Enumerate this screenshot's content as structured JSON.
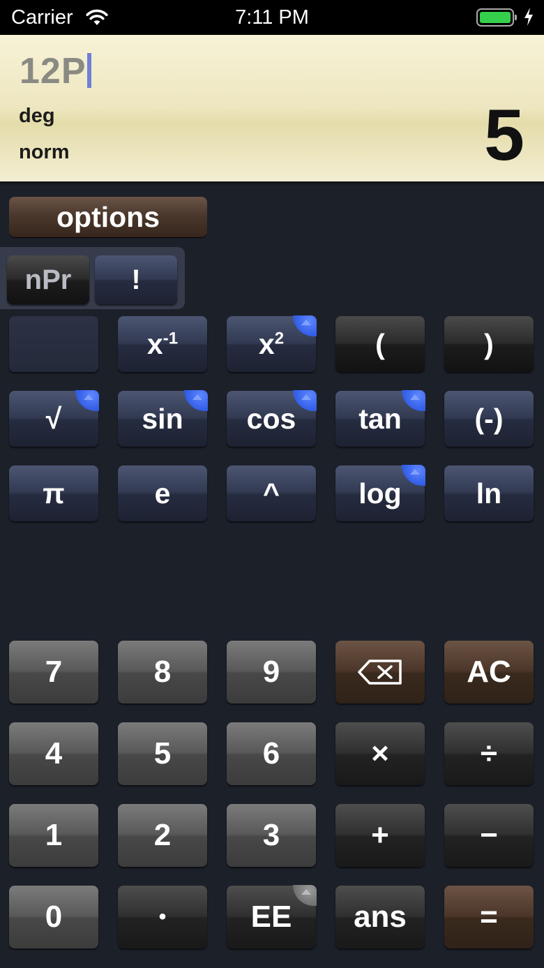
{
  "status_bar": {
    "carrier": "Carrier",
    "time": "7:11 PM"
  },
  "display": {
    "expression": "12P",
    "angle_mode": "deg",
    "number_format": "norm",
    "result": "5"
  },
  "options_button": {
    "label": "options"
  },
  "popup": {
    "npr_label": "nPr",
    "factorial_label": "!"
  },
  "sci": {
    "inv_base": "x",
    "inv_exp": "-1",
    "sq_base": "x",
    "sq_exp": "2",
    "open_paren": "(",
    "close_paren": ")",
    "sqrt": "√",
    "sin": "sin",
    "cos": "cos",
    "tan": "tan",
    "negate": "(-)",
    "pi": "π",
    "e": "e",
    "power": "^",
    "log": "log",
    "ln": "ln"
  },
  "keypad": {
    "seven": "7",
    "eight": "8",
    "nine": "9",
    "backspace": "⌫",
    "clear": "AC",
    "four": "4",
    "five": "5",
    "six": "6",
    "multiply": "×",
    "divide": "÷",
    "one": "1",
    "two": "2",
    "three": "3",
    "plus": "+",
    "minus": "−",
    "zero": "0",
    "decimal": "•",
    "exp": "EE",
    "ans": "ans",
    "equals": "="
  },
  "icons": {
    "wifi": "wifi-icon",
    "battery": "battery-icon",
    "charging": "bolt-icon",
    "shift_corner": "secondary-function-corner-icon"
  }
}
